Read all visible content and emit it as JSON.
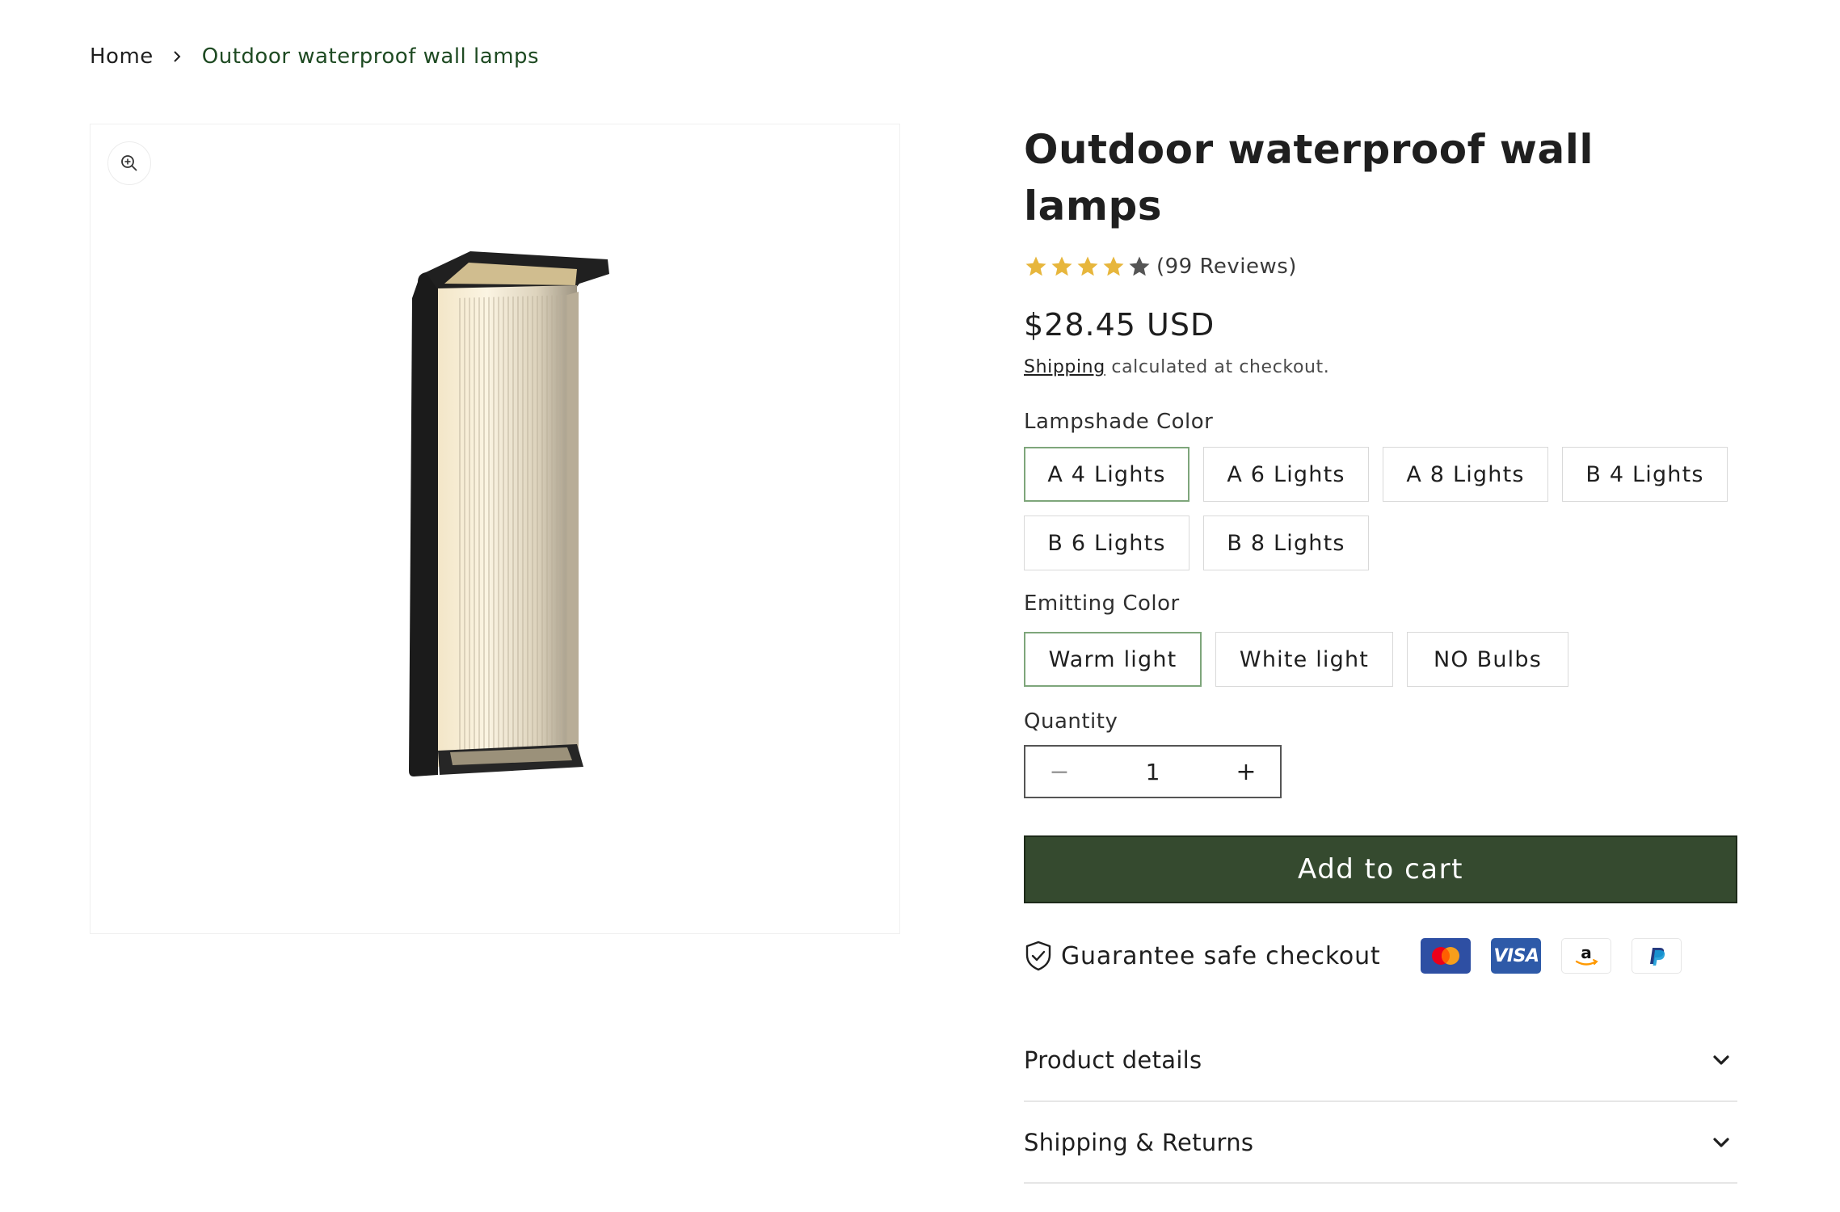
{
  "breadcrumb": {
    "home": "Home",
    "current": "Outdoor waterproof wall lamps"
  },
  "media": {
    "zoom_icon": "zoom-in-icon",
    "image_alt": "Outdoor waterproof wall lamp product image"
  },
  "product": {
    "title": "Outdoor waterproof wall lamps",
    "rating": 4,
    "rating_max": 5,
    "reviews": "(99 Reviews)",
    "price": "$28.45 USD",
    "shipping_link": "Shipping",
    "shipping_suffix": " calculated at checkout."
  },
  "options": {
    "lampshade": {
      "label": "Lampshade Color",
      "values": [
        "A 4 Lights",
        "A 6 Lights",
        "A 8 Lights",
        "B 4 Lights",
        "B 6 Lights",
        "B 8 Lights"
      ],
      "selected": "A 4 Lights"
    },
    "emitting": {
      "label": "Emitting Color",
      "values": [
        "Warm light",
        "White light",
        "NO Bulbs"
      ],
      "selected": "Warm light"
    }
  },
  "quantity": {
    "label": "Quantity",
    "value": "1",
    "minus": "−",
    "plus": "+"
  },
  "cart": {
    "add_label": "Add to cart"
  },
  "guarantee": {
    "text": "Guarantee safe checkout",
    "icon": "shield-check-icon",
    "payments": [
      "mastercard",
      "visa",
      "amazon",
      "paypal"
    ],
    "visa_text": "VISA"
  },
  "accordion": {
    "items": [
      "Product details",
      "Shipping & Returns"
    ]
  },
  "colors": {
    "accent_green": "#354a2f",
    "breadcrumb_green": "#1e4a22",
    "selected_border": "#7ea67b",
    "star_gold": "#e7b63c",
    "star_gray": "#555555"
  }
}
